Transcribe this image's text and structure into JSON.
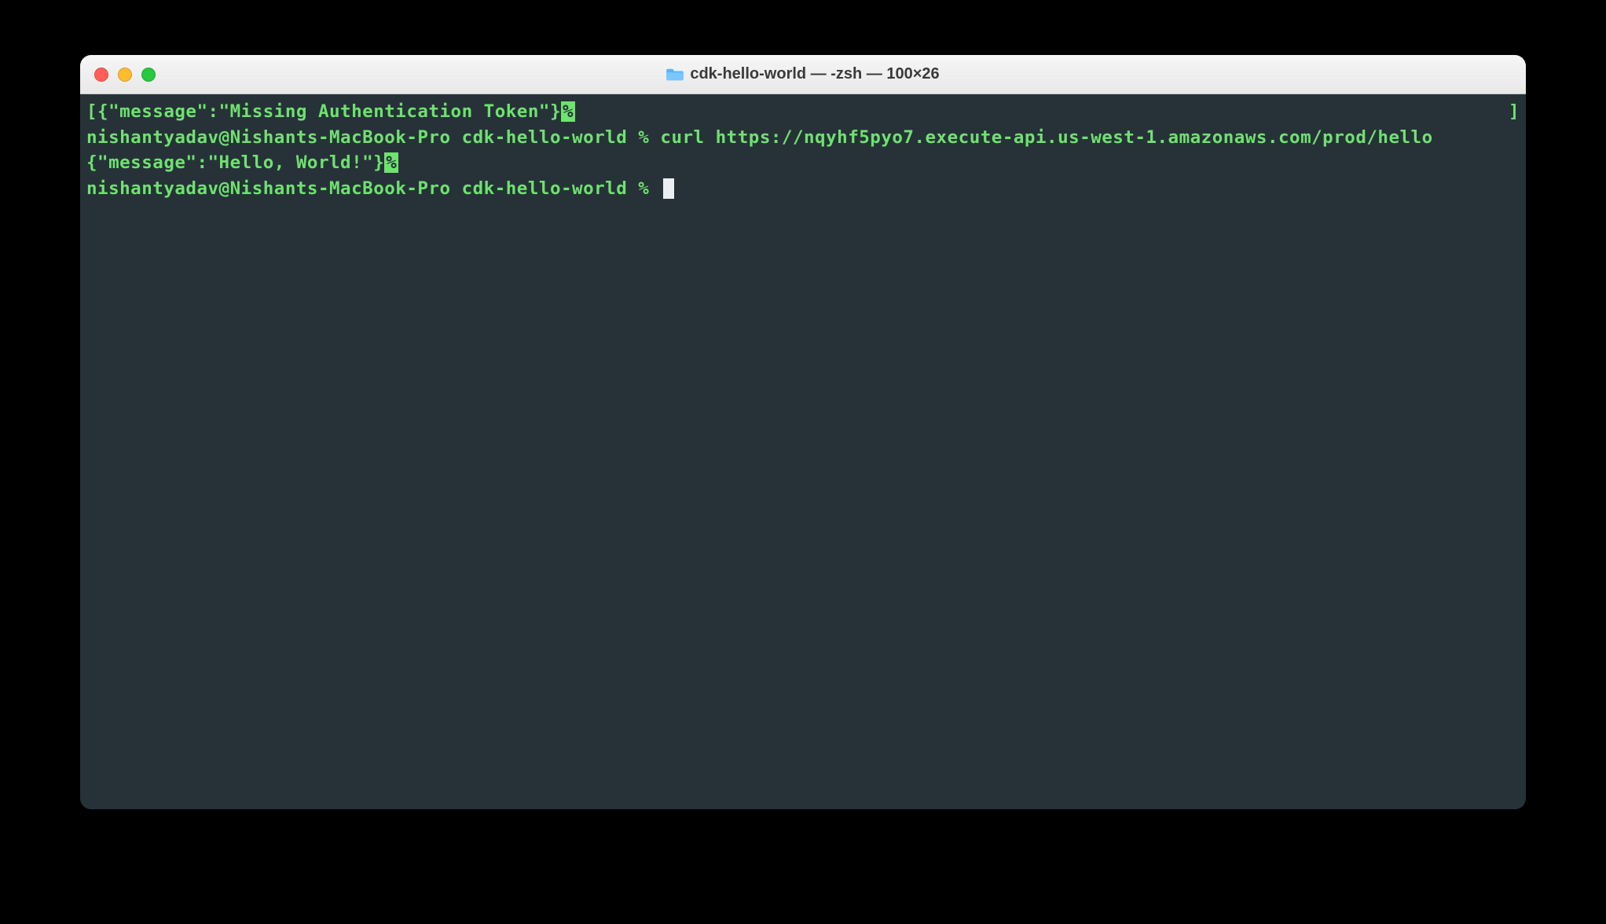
{
  "window": {
    "title": "cdk-hello-world — -zsh — 100×26"
  },
  "terminal": {
    "open_bracket": "[",
    "close_bracket": "]",
    "response1": "{\"message\":\"Missing Authentication Token\"}",
    "eol_marker": "%",
    "prompt1_user": "nishantyadav@Nishants-MacBook-Pro cdk-hello-world % ",
    "command1": "curl https://nqyhf5pyo7.execute-api.us-west-1.amazonaws.com/prod/hello",
    "response2": "{\"message\":\"Hello, World!\"}",
    "prompt2_user": "nishantyadav@Nishants-MacBook-Pro cdk-hello-world % "
  }
}
